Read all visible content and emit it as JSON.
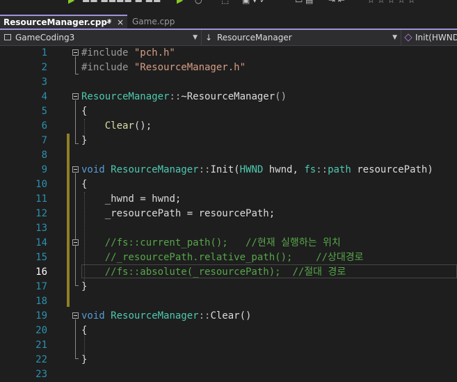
{
  "toolbar": {
    "icons": [
      "run-icon",
      "app-name",
      "debug-icon",
      "undo-icon",
      "redo-icon",
      "save-icon",
      "window-icon",
      "format-icon",
      "star-icon"
    ],
    "partial_label": "... Windows ..."
  },
  "tabs": [
    {
      "label": "ResourceManager.cpp*",
      "pin": "⊸",
      "close": "×",
      "active": true
    },
    {
      "label": "Game.cpp",
      "active": false
    }
  ],
  "navbar": {
    "project": "GameCoding3",
    "scope": "ResourceManager",
    "member": "Init(HWND"
  },
  "editor": {
    "line_numbers": [
      "1",
      "2",
      "3",
      "4",
      "5",
      "6",
      "7",
      "8",
      "9",
      "10",
      "11",
      "12",
      "13",
      "14",
      "15",
      "16",
      "17",
      "18",
      "19",
      "20",
      "21",
      "22",
      "23"
    ],
    "current_line": "16",
    "lines": {
      "l1": {
        "pp": "#include ",
        "str": "\"pch.h\""
      },
      "l2": {
        "pp": "#include ",
        "str": "\"ResourceManager.h\""
      },
      "l4": {
        "t1": "ResourceManager",
        "p1": "::",
        "t2": "~ResourceManager",
        "p2": "()"
      },
      "l5": {
        "t": "{"
      },
      "l6": {
        "f": "Clear",
        "p": "();"
      },
      "l7": {
        "t": "}"
      },
      "l9": {
        "kw": "void",
        "t1": "ResourceManager",
        "p1": "::",
        "f": "Init",
        "p2": "(",
        "ty": "HWND",
        "v1": " hwnd, ",
        "ns": "fs",
        "p3": "::",
        "ty2": "path",
        "v2": " resourcePath)"
      },
      "l10": {
        "t": "{"
      },
      "l11": {
        "v": "_hwnd",
        "p": " = ",
        "v2": "hwnd",
        "e": ";"
      },
      "l12": {
        "v": "_resourcePath",
        "p": " = ",
        "v2": "resourcePath",
        "e": ";"
      },
      "l14": {
        "c": "//fs::current_path();   //현재 실행하는 위치"
      },
      "l15": {
        "c": "//_resourcePath.relative_path();    //상대경로"
      },
      "l16": {
        "c": "//fs::absolute(_resourcePath);  //절대 경로"
      },
      "l17": {
        "t": "}"
      },
      "l19": {
        "kw": "void",
        "t1": "ResourceManager",
        "p1": "::",
        "f": "Clear",
        "p2": "()"
      },
      "l20": {
        "t": "{"
      },
      "l22": {
        "t": "}"
      }
    }
  },
  "colors": {
    "accent": "#9e95d9",
    "keyword": "#569cd6",
    "type": "#4ec9b0",
    "comment": "#57a64a",
    "string": "#d69d85",
    "change_marker": "#8f7f26"
  }
}
